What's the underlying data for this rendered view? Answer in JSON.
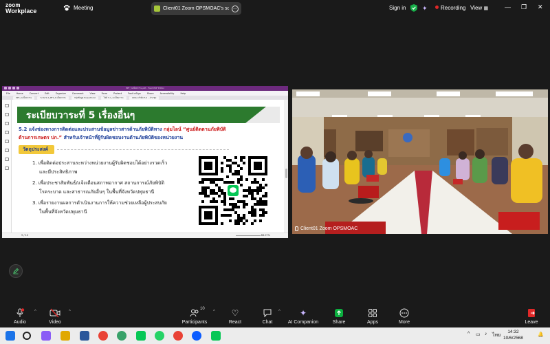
{
  "app": {
    "brand_line1": "zoom",
    "brand_line2": "Workplace",
    "meeting_label": "Meeting",
    "share_pill_label": "Client01 Zoom OPSMOAC's scre",
    "sign_in": "Sign in",
    "recording": "Recording",
    "view": "View",
    "accent_color": "#0b5cff",
    "record_color": "#e02828"
  },
  "pdf": {
    "window_title": "PPT_ระเบียบวาระ.pdf - Foxit PDF Editor",
    "menu": [
      "File",
      "Home",
      "Convert",
      "Edit",
      "Organize",
      "Comment",
      "View",
      "Form",
      "Protect",
      "Foxit eSign",
      "Share",
      "Accessibility",
      "Help"
    ],
    "tabs": [
      "PPT_ระเบียบวาระ",
      "ระบบ 5.2_PPT_ระเบียบวาระ",
      "กลุ่มข้อมูล PowerPoint",
      "ไฟล์ 5.1_ระเบียบวาระ",
      "CDSA ลำดับ 5.2 ...ประชุม"
    ],
    "page_indicator": "9 / 10",
    "zoom_level": "88.07%"
  },
  "slide": {
    "title": "ระเบียบวาระที่ 5   เรื่องอื่นๆ",
    "p1_main": "5.2 แจ้งช่องทางการติดต่อและประสานข้อมูลข่าวสารด้านภัยพิบัติทาง",
    "p1_highlight": "กลุ่มไลน์ “ศูนย์ติดตามภัยพิบัติ",
    "p2_highlight": "ด้านการเกษตร ปก.”",
    "p2_rest": "สำหรับเจ้าหน้าที่ผู้รับผิดชอบงานด้านภัยพิบัติของหน่วยงาน",
    "objective_label": "วัตถุประสงค์",
    "items": [
      "1. เพื่อติดต่อประสานระหว่างหน่วยงานผู้รับผิดชอบได้อย่างรวดเร็ว",
      "และมีประสิทธิภาพ",
      "2. เพื่อประชาสัมพันธ์/แจ้งเตือนสภาพอากาศ สถานการณ์ภัยพิบัติ",
      "โรคระบาด และสาธารณภัยอื่นๆ ในพื้นที่จังหวัดปทุมธานี",
      "3. เพื่อรายงานผลการดำเนินงานการให้ความช่วยเหลือผู้ประสบภัย",
      "ในพื้นที่จังหวัดปทุมธานี"
    ],
    "header_color": "#2c7a2e",
    "title_color": "#1d3f9a",
    "highlight_color": "#cc1818",
    "tag_color": "#f2c83a"
  },
  "video": {
    "participant_label": "Client01 Zoom OPSMOAC"
  },
  "toolbar": {
    "audio": "Audio",
    "video": "Video",
    "participants": "Participants",
    "participants_count": "10",
    "react": "React",
    "chat": "Chat",
    "ai_companion": "AI Companion",
    "share": "Share",
    "apps": "Apps",
    "more": "More",
    "leave": "Leave",
    "share_color": "#0bb03f",
    "leave_color": "#e02828"
  },
  "taskbar": {
    "lang": "ไทย",
    "time": "14:32",
    "date": "10/6/2568"
  }
}
